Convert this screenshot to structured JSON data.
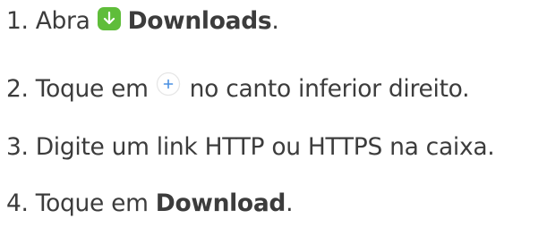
{
  "steps": [
    {
      "number": "1.",
      "text_before": "Abra",
      "icon": "downloads-app-icon",
      "bold": "Downloads",
      "text_after": "."
    },
    {
      "number": "2.",
      "text_before": "Toque em",
      "icon": "add-plus-icon",
      "text_after": "no canto inferior direito."
    },
    {
      "number": "3.",
      "text": "Digite um link HTTP ou HTTPS na caixa."
    },
    {
      "number": "4.",
      "text_before": "Toque em",
      "bold": "Download",
      "text_after": "."
    }
  ],
  "colors": {
    "text": "#3c3c3c",
    "downloads_icon_bg": "#5fbd3a",
    "plus_icon_accent": "#4a90e2"
  }
}
